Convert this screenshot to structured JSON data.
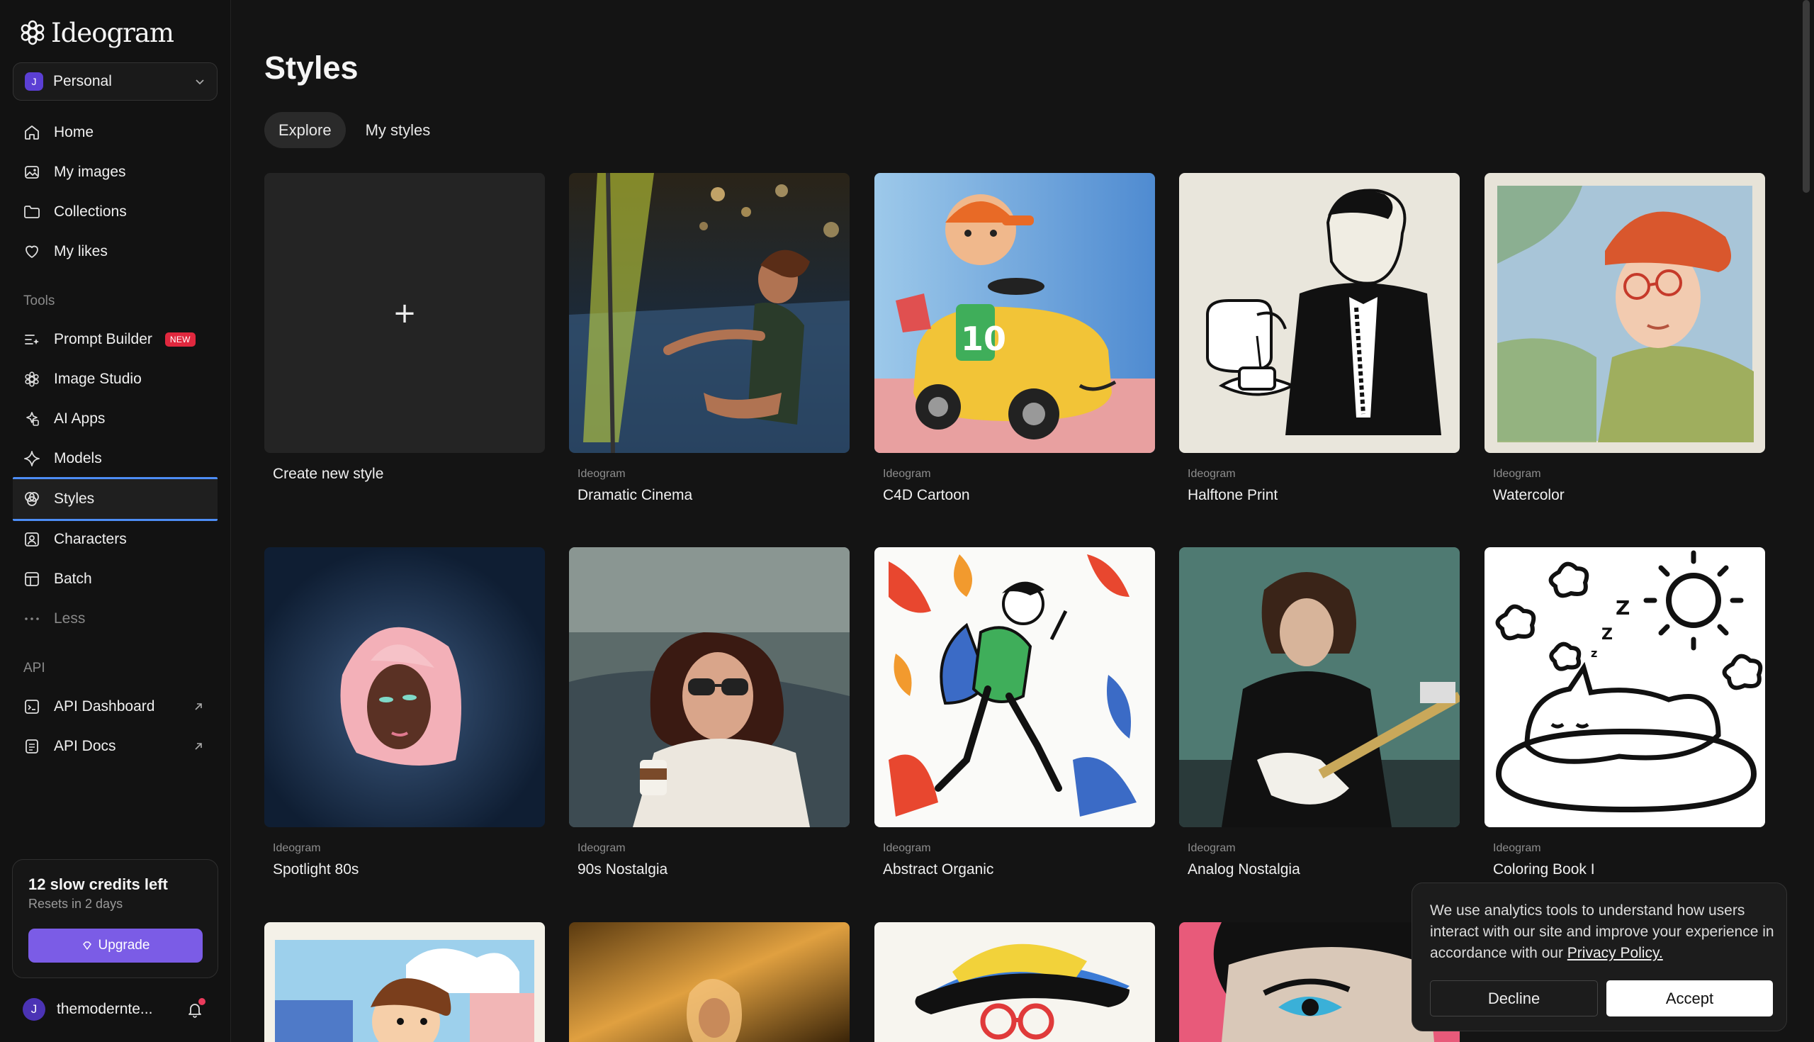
{
  "app": {
    "logo_text": "Ideogram"
  },
  "workspace": {
    "avatar_letter": "J",
    "label": "Personal"
  },
  "nav": {
    "main": [
      {
        "label": "Home",
        "icon": "home-icon"
      },
      {
        "label": "My images",
        "icon": "images-icon"
      },
      {
        "label": "Collections",
        "icon": "folder-icon"
      },
      {
        "label": "My likes",
        "icon": "heart-icon"
      }
    ],
    "tools_title": "Tools",
    "tools": [
      {
        "label": "Prompt Builder",
        "icon": "prompt-builder-icon",
        "badge": "NEW"
      },
      {
        "label": "Image Studio",
        "icon": "image-studio-icon"
      },
      {
        "label": "AI Apps",
        "icon": "apps-icon"
      },
      {
        "label": "Models",
        "icon": "sparkle-icon"
      },
      {
        "label": "Styles",
        "icon": "styles-icon",
        "active": true
      },
      {
        "label": "Characters",
        "icon": "characters-icon"
      },
      {
        "label": "Batch",
        "icon": "batch-icon"
      },
      {
        "label": "Less",
        "icon": "more-icon"
      }
    ],
    "api_title": "API",
    "api": [
      {
        "label": "API Dashboard",
        "icon": "api-dashboard-icon"
      },
      {
        "label": "API Docs",
        "icon": "api-docs-icon"
      }
    ]
  },
  "credits": {
    "title": "12 slow credits left",
    "subtitle": "Resets in 2 days",
    "upgrade_label": "Upgrade"
  },
  "user": {
    "avatar_letter": "J",
    "name": "themodernte..."
  },
  "page": {
    "title": "Styles",
    "tabs": [
      "Explore",
      "My styles"
    ],
    "create_label": "Create new style",
    "styles": [
      {
        "author": "Ideogram",
        "name": "Dramatic Cinema"
      },
      {
        "author": "Ideogram",
        "name": "C4D Cartoon"
      },
      {
        "author": "Ideogram",
        "name": "Halftone Print"
      },
      {
        "author": "Ideogram",
        "name": "Watercolor"
      },
      {
        "author": "Ideogram",
        "name": "Spotlight 80s"
      },
      {
        "author": "Ideogram",
        "name": "90s Nostalgia"
      },
      {
        "author": "Ideogram",
        "name": "Abstract Organic"
      },
      {
        "author": "Ideogram",
        "name": "Analog Nostalgia"
      },
      {
        "author": "Ideogram",
        "name": "Coloring Book I"
      }
    ]
  },
  "cookie": {
    "text": "We use analytics tools to understand how users interact with our site and improve your experience in accordance with our ",
    "link": "Privacy Policy.",
    "decline": "Decline",
    "accept": "Accept"
  },
  "colors": {
    "accent": "#7b5ce6",
    "active_border": "#4d8df5",
    "badge": "#e0283e"
  }
}
